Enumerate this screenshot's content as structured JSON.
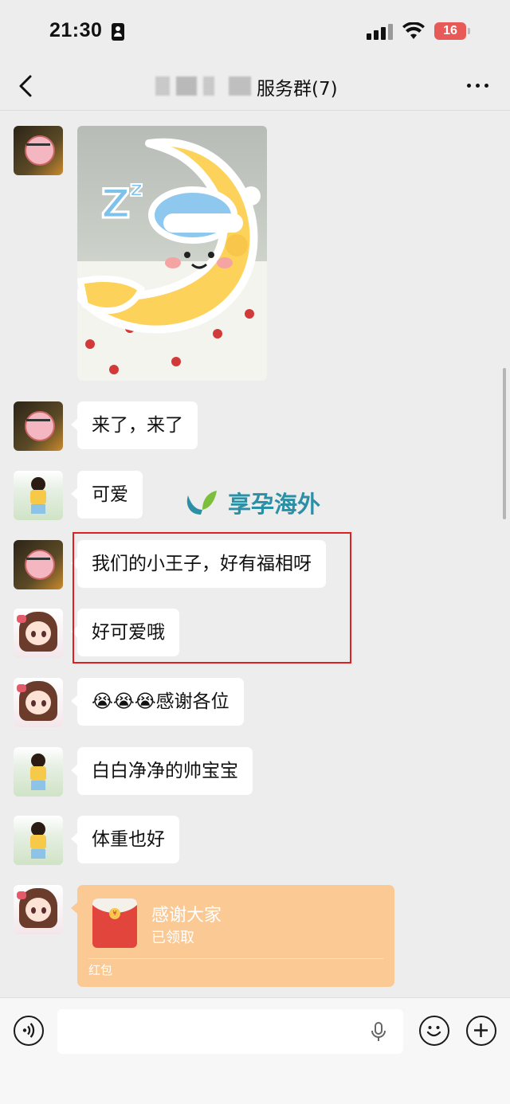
{
  "status_bar": {
    "time": "21:30",
    "battery": "16"
  },
  "nav": {
    "title": "服务群(7)"
  },
  "messages": [
    {
      "type": "image",
      "sender": "a"
    },
    {
      "type": "text",
      "sender": "a",
      "text": "来了，来了"
    },
    {
      "type": "text",
      "sender": "b",
      "text": "可爱"
    },
    {
      "type": "text",
      "sender": "a",
      "text": "我们的小王子，好有福相呀"
    },
    {
      "type": "text",
      "sender": "c",
      "text": "好可爱哦"
    },
    {
      "type": "text",
      "sender": "c",
      "text": "😭😭😭感谢各位"
    },
    {
      "type": "text",
      "sender": "b",
      "text": "白白净净的帅宝宝"
    },
    {
      "type": "text",
      "sender": "b",
      "text": "体重也好"
    }
  ],
  "red_packet": {
    "title": "感谢大家",
    "status": "已领取",
    "label": "红包"
  },
  "watermark": {
    "text": "享孕海外"
  },
  "sticker": {
    "text": "Z",
    "small_text": "z"
  },
  "input": {
    "placeholder": ""
  },
  "icons": [
    "back-icon",
    "more-icon",
    "voice-icon",
    "mic-icon",
    "emoji-icon",
    "plus-icon",
    "red-packet-icon"
  ],
  "colors": {
    "background": "#ededed",
    "bubble": "#ffffff",
    "red_packet": "#fac994",
    "highlight_box": "#e02020",
    "watermark": "#2b8fa6"
  }
}
